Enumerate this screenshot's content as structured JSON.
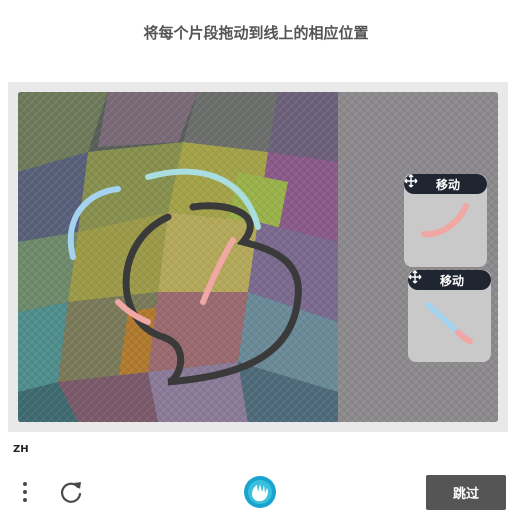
{
  "header": {
    "title": "将每个片段拖动到线上的相应位置"
  },
  "pieces": [
    {
      "label": "移动",
      "icon": "move-icon",
      "segment_color": "#f1a7a3"
    },
    {
      "label": "移动",
      "icon": "move-icon",
      "segment_color": "#a5d3ef"
    }
  ],
  "footer": {
    "language": "ZH",
    "menu_icon": "more-vertical-icon",
    "refresh_icon": "refresh-icon",
    "logo_icon": "hand-logo-icon",
    "skip_label": "跳过"
  },
  "colors": {
    "skip_button": "#555555",
    "piece_header": "#1f2531",
    "path_dark": "#3a3a3a",
    "segment_blue": "#a5d3ef",
    "segment_pink": "#f1a7a3"
  }
}
